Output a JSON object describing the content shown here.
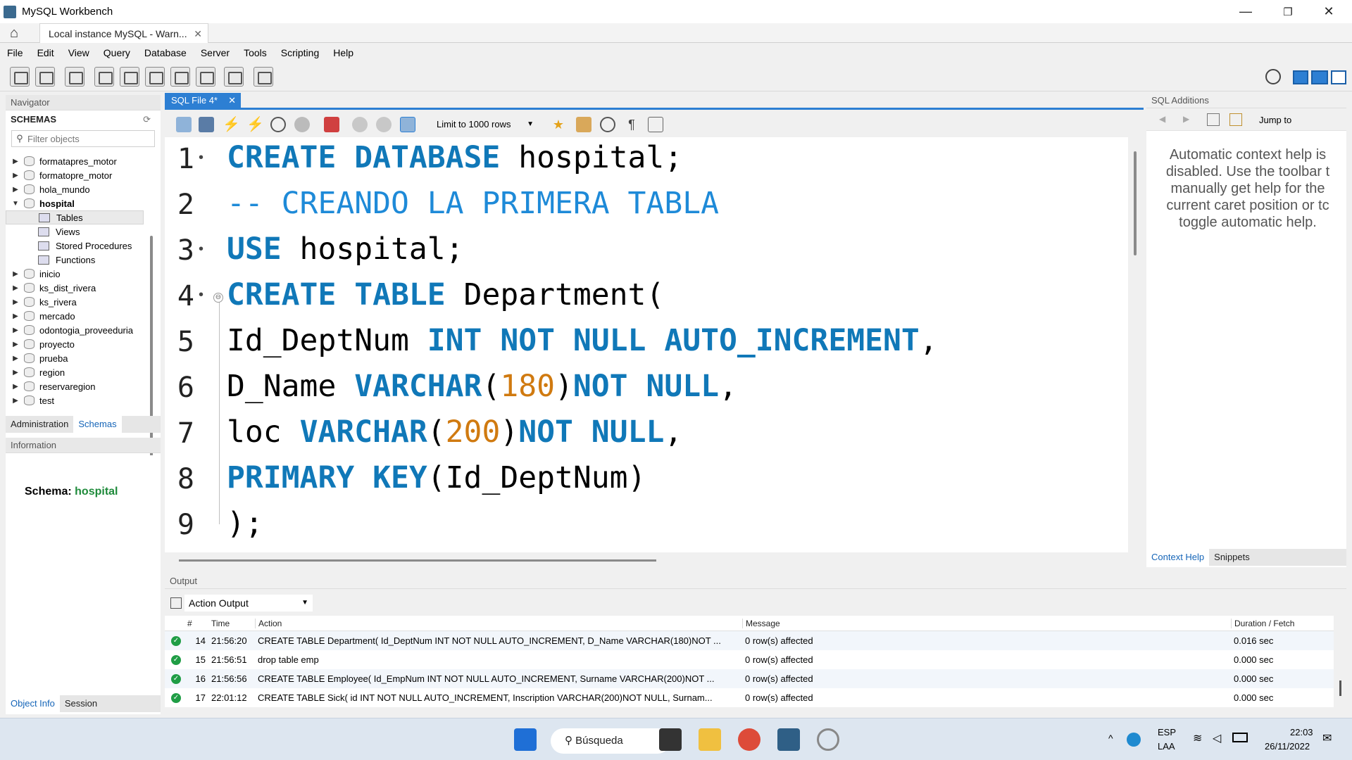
{
  "window": {
    "title": "MySQL Workbench",
    "connection_tab": "Local instance MySQL - Warn...",
    "minimize": "—",
    "restore": "❐",
    "close": "✕"
  },
  "menu": [
    "File",
    "Edit",
    "View",
    "Query",
    "Database",
    "Server",
    "Tools",
    "Scripting",
    "Help"
  ],
  "navigator": {
    "header": "Navigator",
    "schemas_label": "SCHEMAS",
    "filter_placeholder": "Filter objects",
    "schemas_before": [
      "formatapres_motor",
      "formatopre_motor",
      "hola_mundo"
    ],
    "expanded": {
      "name": "hospital",
      "children": [
        "Tables",
        "Views",
        "Stored Procedures",
        "Functions"
      ]
    },
    "schemas_after": [
      "inicio",
      "ks_dist_rivera",
      "ks_rivera",
      "mercado",
      "odontogia_proveeduria",
      "proyecto",
      "prueba",
      "region",
      "reservaregion",
      "test"
    ],
    "tabs": {
      "administration": "Administration",
      "schemas": "Schemas"
    }
  },
  "information": {
    "header": "Information",
    "schema_label": "Schema:",
    "schema_value": "hospital",
    "tabs": {
      "object_info": "Object Info",
      "session": "Session"
    }
  },
  "editor": {
    "tab_label": "SQL File 4*",
    "limit_label": "Limit to 1000 rows",
    "line_numbers": [
      "1",
      "2",
      "3",
      "4",
      "5",
      "6",
      "7",
      "8",
      "9"
    ]
  },
  "sql_additions": {
    "header": "SQL Additions",
    "jump_to": "Jump to",
    "help_text": "Automatic context help is disabled. Use the toolbar t manually get help for the current caret position or tc toggle automatic help.",
    "tabs": {
      "context_help": "Context Help",
      "snippets": "Snippets"
    }
  },
  "output": {
    "header": "Output",
    "selector": "Action Output",
    "columns": {
      "num": "#",
      "time": "Time",
      "action": "Action",
      "message": "Message",
      "duration": "Duration / Fetch"
    },
    "rows": [
      {
        "num": "14",
        "time": "21:56:20",
        "action": "CREATE TABLE Department( Id_DeptNum INT NOT NULL AUTO_INCREMENT, D_Name VARCHAR(180)NOT ...",
        "message": "0 row(s) affected",
        "duration": "0.016 sec"
      },
      {
        "num": "15",
        "time": "21:56:51",
        "action": "drop table emp",
        "message": "0 row(s) affected",
        "duration": "0.000 sec"
      },
      {
        "num": "16",
        "time": "21:56:56",
        "action": "CREATE TABLE Employee(  Id_EmpNum INT NOT NULL AUTO_INCREMENT,  Surname VARCHAR(200)NOT ...",
        "message": "0 row(s) affected",
        "duration": "0.000 sec"
      },
      {
        "num": "17",
        "time": "22:01:12",
        "action": "CREATE TABLE Sick(  id INT NOT NULL AUTO_INCREMENT,  Inscription VARCHAR(200)NOT NULL,  Surnam...",
        "message": "0 row(s) affected",
        "duration": "0.000 sec"
      }
    ]
  },
  "taskbar": {
    "search_label": "Búsqueda",
    "lang": "ESP",
    "layout": "LAA",
    "time": "22:03",
    "date": "26/11/2022"
  }
}
